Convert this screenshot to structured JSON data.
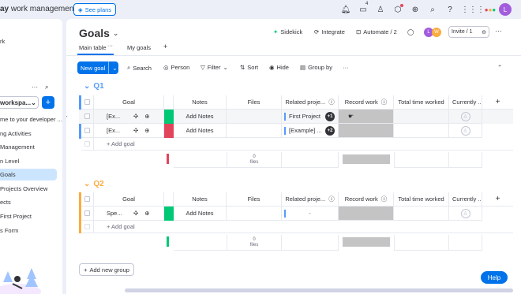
{
  "topbar": {
    "brand_bold": "ay",
    "brand_rest": " work management",
    "see_plans": "See plans",
    "inbox_count": "4"
  },
  "sidebar": {
    "items": [
      "rk",
      "workspa...",
      "me to your developer ...",
      "ng Activities",
      "Management",
      "n Level",
      "Goals",
      "Projects Overview",
      "ects",
      "First Project",
      "s Form"
    ],
    "more": "···",
    "add": "+"
  },
  "header": {
    "title": "Goals",
    "sidekick": "Sidekick",
    "integrate": "Integrate",
    "automate": "Automate / 2",
    "invite": "Invite / 1",
    "more": "···"
  },
  "tabs": [
    "Main table",
    "My goals"
  ],
  "tab_more": "···",
  "toolbar": {
    "new_goal": "New goal",
    "search": "Search",
    "person": "Person",
    "filter": "Filter",
    "sort": "Sort",
    "hide": "Hide",
    "group_by": "Group by",
    "more": "···"
  },
  "columns": [
    "Goal",
    "Notes",
    "Files",
    "Related proje...",
    "Record work",
    "Total time worked",
    "Currently ..."
  ],
  "groups": [
    {
      "name": "Q1",
      "color": "#579bfc",
      "rows": [
        {
          "goal": "[Ex...",
          "notes": "Add Notes",
          "status_color": "#00c875",
          "related": "First Project",
          "related_badge": "+1",
          "row_more": "···"
        },
        {
          "goal": "[Ex...",
          "notes": "Add Notes",
          "status_color": "#e2445c",
          "related": "[Example] ...",
          "related_badge": "+2",
          "row_more": ""
        }
      ],
      "add_label": "+ Add goal",
      "summary_files_count": "0",
      "summary_files_label": "files",
      "summary_status_color": "#e2445c"
    },
    {
      "name": "Q2",
      "color": "#fdab3d",
      "rows": [
        {
          "goal": "Spe...",
          "notes": "Add Notes",
          "status_color": "#00c875",
          "related": "-",
          "related_badge": "",
          "row_more": ""
        }
      ],
      "add_label": "+ Add goal",
      "summary_files_count": "0",
      "summary_files_label": "files",
      "summary_status_color": "#00c875"
    }
  ],
  "add_new_group": "Add new group",
  "help": "Help",
  "avatars": [
    "L",
    "W"
  ],
  "user_initial": "L",
  "icons": [
    "bell-icon",
    "inbox-icon",
    "invite-members-icon",
    "apps-icon",
    "integrations-icon",
    "search-icon",
    "help-icon",
    "grid-icon",
    "logo-icon"
  ]
}
